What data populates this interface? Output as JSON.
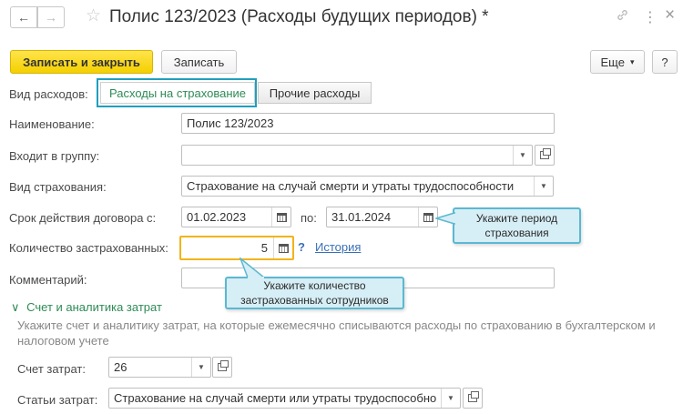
{
  "window": {
    "back_glyph": "←",
    "forward_glyph": "→",
    "favorite_glyph": "☆",
    "title": "Полис 123/2023 (Расходы будущих периодов) *",
    "link_glyph": "🔗",
    "menu_glyph": "⋮",
    "close_glyph": "×",
    "icons": [
      "arrow-left-icon",
      "arrow-right-icon",
      "star-icon",
      "link-icon",
      "kebab-icon",
      "close-icon"
    ]
  },
  "toolbar": {
    "save_close_label": "Записать и закрыть",
    "save_label": "Записать",
    "more_label": "Еще",
    "more_caret": "▾",
    "help_label": "?"
  },
  "form": {
    "expense_type": {
      "label": "Вид расходов:",
      "options": [
        "Расходы на страхование",
        "Прочие расходы"
      ],
      "selected": "Расходы на страхование"
    },
    "name": {
      "label": "Наименование:",
      "value": "Полис 123/2023"
    },
    "group": {
      "label": "Входит в группу:",
      "value": ""
    },
    "insurance_type": {
      "label": "Вид страхования:",
      "value": "Страхование на случай смерти и утраты трудоспособности"
    },
    "term": {
      "label": "Срок действия договора с:",
      "from": "01.02.2023",
      "to_label": "по:",
      "to": "31.01.2024"
    },
    "insured_count": {
      "label": "Количество застрахованных:",
      "value": "5",
      "help": "?",
      "history_link": "История"
    },
    "comment": {
      "label": "Комментарий:",
      "value": ""
    }
  },
  "callouts": {
    "period": "Укажите период страхования",
    "count": "Укажите количество застрахованных сотрудников"
  },
  "section": {
    "chevron": "∨",
    "title": "Счет и аналитика затрат",
    "hint": "Укажите счет и аналитику затрат, на которые ежемесячно списываются расходы по страхованию в бухгалтерском и налоговом учете",
    "account": {
      "label": "Счет затрат:",
      "value": "26"
    },
    "cost_items": {
      "label": "Статьи затрат:",
      "value": "Страхование на случай смерти или утраты трудоспособно"
    }
  },
  "colors": {
    "primary_button": "#f4d000",
    "active_toggle_border": "#1f9fbf",
    "active_toggle_text": "#2e8b57",
    "highlight_field_border": "#f2b31a",
    "callout_fill": "#d6eef5",
    "callout_border": "#5bb8d1",
    "link": "#3a6fb8"
  }
}
